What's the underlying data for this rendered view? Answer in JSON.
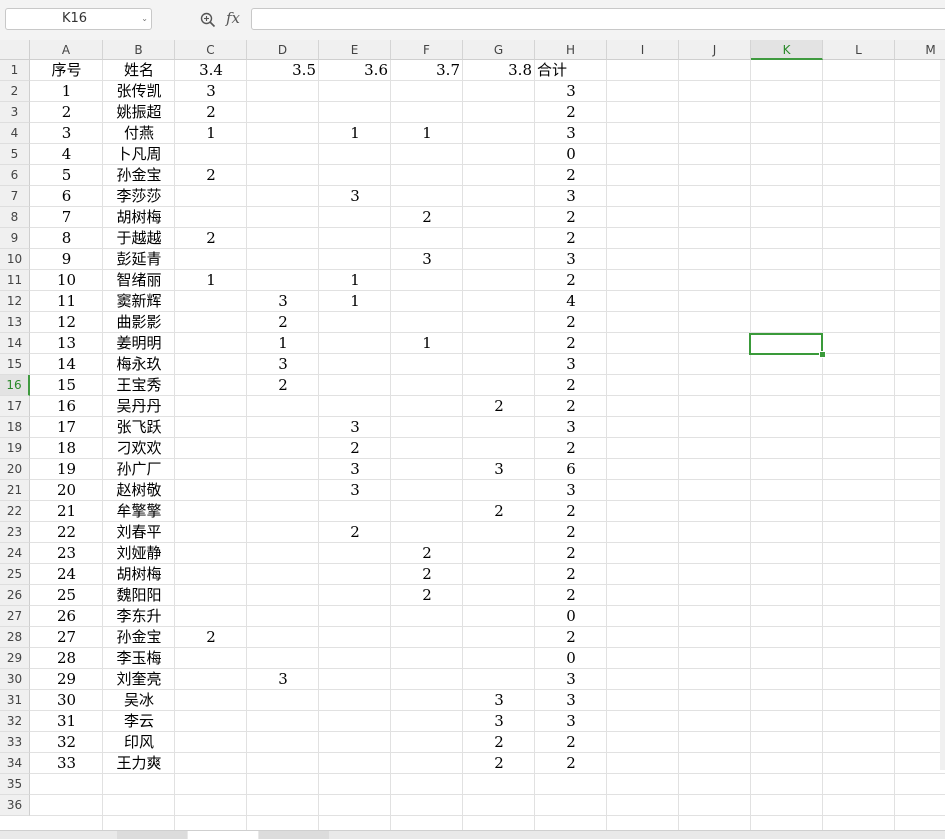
{
  "formula_bar": {
    "name_box": "K16",
    "fx_label": "fx",
    "formula": ""
  },
  "columns": [
    "A",
    "B",
    "C",
    "D",
    "E",
    "F",
    "G",
    "H",
    "I",
    "J",
    "K",
    "L",
    "M"
  ],
  "active_column": "K",
  "active_row": 16,
  "row_numbers": [
    1,
    2,
    3,
    4,
    5,
    6,
    7,
    8,
    9,
    10,
    11,
    12,
    13,
    14,
    15,
    16,
    17,
    18,
    19,
    20,
    21,
    22,
    23,
    24,
    25,
    26,
    27,
    28,
    29,
    30,
    31,
    32,
    33,
    34,
    35,
    36
  ],
  "header_row": [
    "序号",
    "姓名",
    "3.4",
    "3.5",
    "3.6",
    "3.7",
    "3.8",
    "合计"
  ],
  "rows": [
    [
      "1",
      "张传凯",
      "3",
      "",
      "",
      "",
      "",
      "3"
    ],
    [
      "2",
      "姚振超",
      "2",
      "",
      "",
      "",
      "",
      "2"
    ],
    [
      "3",
      "付燕",
      "1",
      "",
      "1",
      "1",
      "",
      "3"
    ],
    [
      "4",
      "卜凡周",
      "",
      "",
      "",
      "",
      "",
      "0"
    ],
    [
      "5",
      "孙金宝",
      "2",
      "",
      "",
      "",
      "",
      "2"
    ],
    [
      "6",
      "李莎莎",
      "",
      "",
      "3",
      "",
      "",
      "3"
    ],
    [
      "7",
      "胡树梅",
      "",
      "",
      "",
      "2",
      "",
      "2"
    ],
    [
      "8",
      "于越越",
      "2",
      "",
      "",
      "",
      "",
      "2"
    ],
    [
      "9",
      "彭延青",
      "",
      "",
      "",
      "3",
      "",
      "3"
    ],
    [
      "10",
      "智绪丽",
      "1",
      "",
      "1",
      "",
      "",
      "2"
    ],
    [
      "11",
      "窦新辉",
      "",
      "3",
      "1",
      "",
      "",
      "4"
    ],
    [
      "12",
      "曲影影",
      "",
      "2",
      "",
      "",
      "",
      "2"
    ],
    [
      "13",
      "姜明明",
      "",
      "1",
      "",
      "1",
      "",
      "2"
    ],
    [
      "14",
      "梅永玖",
      "",
      "3",
      "",
      "",
      "",
      "3"
    ],
    [
      "15",
      "王宝秀",
      "",
      "2",
      "",
      "",
      "",
      "2"
    ],
    [
      "16",
      "吴丹丹",
      "",
      "",
      "",
      "",
      "2",
      "2"
    ],
    [
      "17",
      "张飞跃",
      "",
      "",
      "3",
      "",
      "",
      "3"
    ],
    [
      "18",
      "刁欢欢",
      "",
      "",
      "2",
      "",
      "",
      "2"
    ],
    [
      "19",
      "孙广厂",
      "",
      "",
      "3",
      "",
      "3",
      "6"
    ],
    [
      "20",
      "赵树敬",
      "",
      "",
      "3",
      "",
      "",
      "3"
    ],
    [
      "21",
      "牟擎擎",
      "",
      "",
      "",
      "",
      "2",
      "2"
    ],
    [
      "22",
      "刘春平",
      "",
      "",
      "2",
      "",
      "",
      "2"
    ],
    [
      "23",
      "刘娅静",
      "",
      "",
      "",
      "2",
      "",
      "2"
    ],
    [
      "24",
      "胡树梅",
      "",
      "",
      "",
      "2",
      "",
      "2"
    ],
    [
      "25",
      "魏阳阳",
      "",
      "",
      "",
      "2",
      "",
      "2"
    ],
    [
      "26",
      "李东升",
      "",
      "",
      "",
      "",
      "",
      "0"
    ],
    [
      "27",
      "孙金宝",
      "2",
      "",
      "",
      "",
      "",
      "2"
    ],
    [
      "28",
      "李玉梅",
      "",
      "",
      "",
      "",
      "",
      "0"
    ],
    [
      "29",
      "刘奎亮",
      "",
      "3",
      "",
      "",
      "",
      "3"
    ],
    [
      "30",
      "吴冰",
      "",
      "",
      "",
      "",
      "3",
      "3"
    ],
    [
      "31",
      "李云",
      "",
      "",
      "",
      "",
      "3",
      "3"
    ],
    [
      "32",
      "印风",
      "",
      "",
      "",
      "",
      "2",
      "2"
    ],
    [
      "33",
      "王力爽",
      "",
      "",
      "",
      "",
      "2",
      "2"
    ]
  ],
  "colors": {
    "accent": "#3a9a3a",
    "header_bg": "#f0f0f0",
    "grid": "#e1e1e1"
  }
}
